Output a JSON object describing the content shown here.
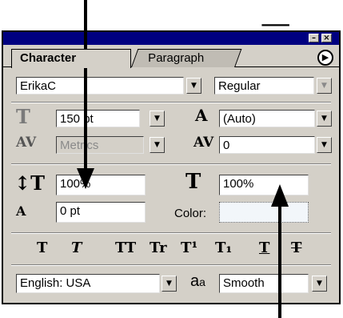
{
  "top_glyph": "_",
  "palette": {
    "title_buttons": [
      "–",
      "×"
    ],
    "tabs": [
      {
        "label": "Character",
        "active": true
      },
      {
        "label": "Paragraph",
        "active": false
      }
    ],
    "menu_icon": "triangle-right-icon",
    "font_family": {
      "value": "ErikaC"
    },
    "font_style": {
      "value": "Regular"
    },
    "font_size": {
      "value": "150 pt"
    },
    "leading": {
      "value": "(Auto)"
    },
    "kerning": {
      "value": "Metrics"
    },
    "tracking": {
      "value": "0"
    },
    "vertical_scale": {
      "value": "100%"
    },
    "horizontal_scale": {
      "value": "100%"
    },
    "baseline_shift": {
      "value": "0 pt"
    },
    "color_label": "Color:",
    "style_buttons": [
      "T",
      "T",
      "TT",
      "Tr",
      "T¹",
      "T₁",
      "T",
      "T"
    ],
    "language": {
      "value": "English: USA"
    },
    "antialias_icon_text": "a",
    "antialias_icon_text2": "a",
    "antialias": {
      "value": "Smooth"
    }
  }
}
